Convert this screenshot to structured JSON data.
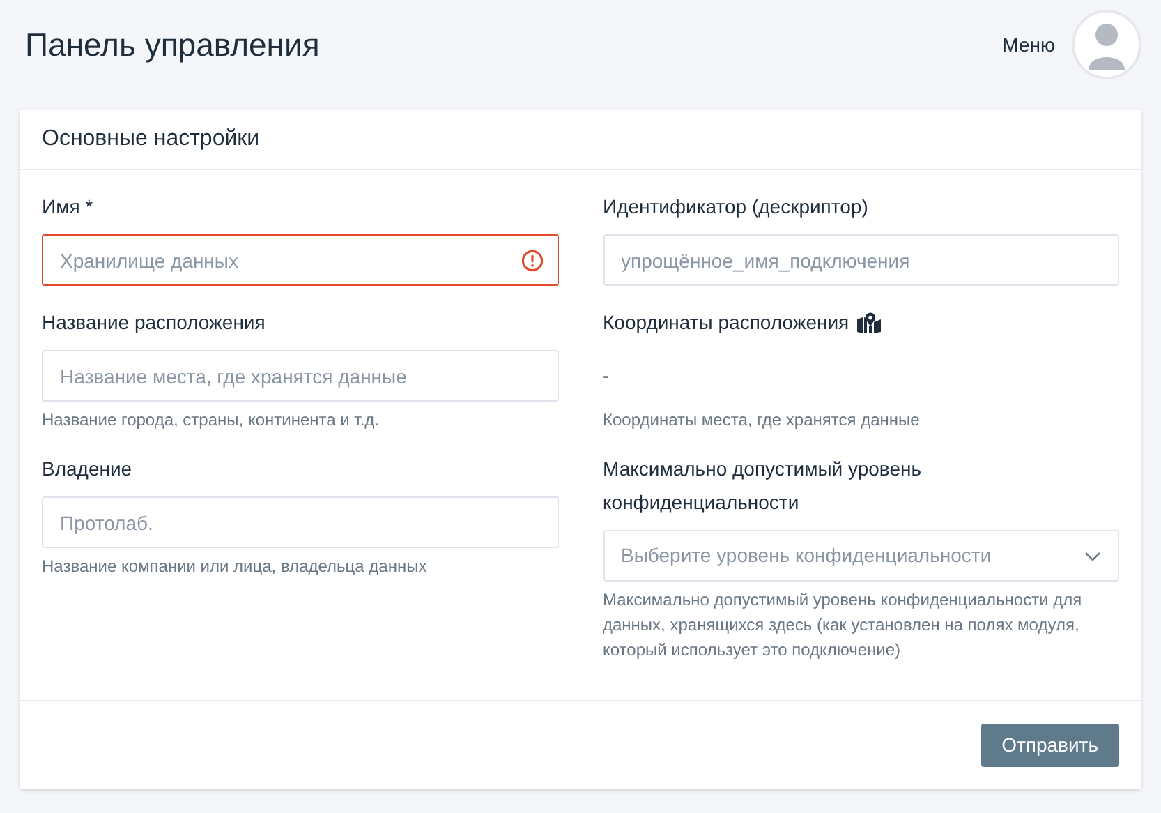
{
  "header": {
    "title": "Панель управления",
    "menu_label": "Меню"
  },
  "card": {
    "title": "Основные настройки",
    "columns": [
      [
        {
          "kind": "input",
          "label": "Имя *",
          "placeholder": "Хранилище данных",
          "error": true
        },
        {
          "kind": "input",
          "label": "Название расположения",
          "placeholder": "Название места, где хранятся данные",
          "error": false,
          "hint": "Название города, страны, континента и т.д."
        },
        {
          "kind": "input",
          "label": "Владение",
          "placeholder": "Протолаб.",
          "error": false,
          "hint": "Название компании или лица, владельца данных"
        }
      ],
      [
        {
          "kind": "input",
          "label": "Идентификатор (дескриптор)",
          "placeholder": "упрощённое_имя_подключения",
          "error": false
        },
        {
          "kind": "static",
          "label": "Координаты расположения",
          "value": "-",
          "hint": "Координаты места, где хранятся данные"
        },
        {
          "kind": "select",
          "label": "Максимально допустимый уровень конфиденциальности",
          "placeholder": "Выберите уровень конфиденциальности",
          "hint": "Максимально допустимый уровень конфиденциальности для данных, хранящихся здесь (как установлен на полях модуля, который использует это подключение)"
        }
      ]
    ],
    "submit_label": "Отправить"
  }
}
